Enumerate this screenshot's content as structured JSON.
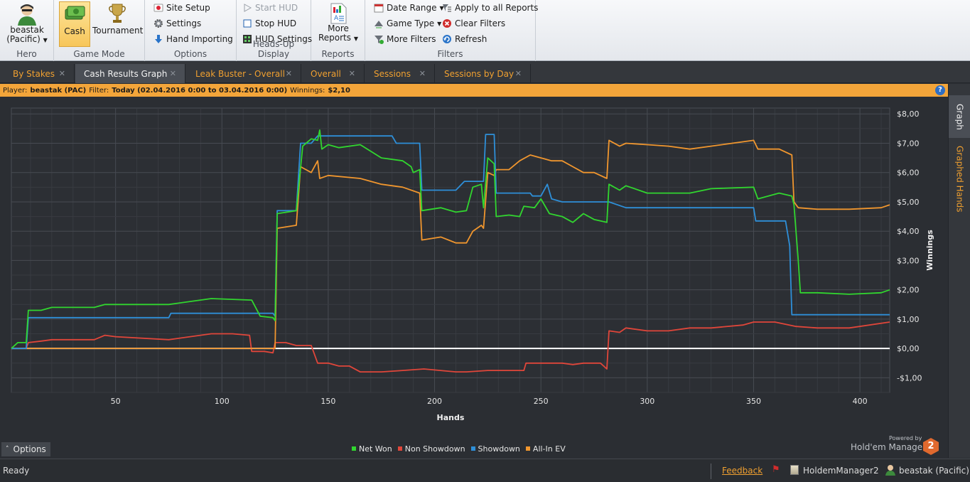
{
  "ribbon": {
    "hero": {
      "user_line1": "beastak",
      "user_line2": "(Pacific)",
      "group_label": "Hero"
    },
    "game_mode": {
      "cash": "Cash",
      "tournament": "Tournament",
      "group_label": "Game Mode"
    },
    "options": {
      "site_setup": "Site Setup",
      "settings": "Settings",
      "hand_importing": "Hand Importing",
      "group_label": "Options"
    },
    "hud": {
      "start_hud": "Start HUD",
      "stop_hud": "Stop HUD",
      "hud_settings": "HUD Settings",
      "group_label": "Heads-Up Display"
    },
    "reports": {
      "more_line1": "More",
      "more_line2": "Reports",
      "group_label": "Reports"
    },
    "filters": {
      "date_range": "Date Range",
      "game_type": "Game Type",
      "more_filters": "More Filters",
      "apply_all": "Apply to all Reports",
      "clear_filters": "Clear Filters",
      "refresh": "Refresh",
      "group_label": "Filters"
    }
  },
  "tabs": [
    {
      "label": "By Stakes"
    },
    {
      "label": "Cash Results Graph"
    },
    {
      "label": "Leak Buster - Overall"
    },
    {
      "label": "Overall"
    },
    {
      "label": "Sessions"
    },
    {
      "label": "Sessions by Day"
    }
  ],
  "active_tab": 1,
  "infobar": {
    "player_label": "Player:",
    "player_value": "beastak (PAC)",
    "filter_label": "Filter:",
    "filter_value": "Today (02.04.2016 0:00 to 03.04.2016 0:00)",
    "winnings_label": "Winnings:",
    "winnings_value": "$2,10",
    "help": "?"
  },
  "side_tabs": {
    "graph": "Graph",
    "graphed_hands": "Graphed Hands"
  },
  "options_button": "Options",
  "brand": {
    "powered_by": "Powered by",
    "name": "Hold'em Manager",
    "version": "2"
  },
  "status": {
    "ready": "Ready",
    "feedback": "Feedback",
    "db": "HoldemManager2",
    "user": "beastak (Pacific)"
  },
  "colors": {
    "net_won": "#31d62f",
    "non_showdown": "#e0463a",
    "showdown": "#2e8fd8",
    "allin_ev": "#f0962e",
    "accent": "#f3a53a"
  },
  "chart_data": {
    "type": "line",
    "xlabel": "Hands",
    "ylabel": "Winnings",
    "xlim": [
      1,
      414
    ],
    "ylim": [
      -1.5,
      8.2
    ],
    "x_ticks": [
      50,
      100,
      150,
      200,
      250,
      300,
      350,
      400
    ],
    "y_ticks": [
      {
        "v": 8,
        "label": "$8,00"
      },
      {
        "v": 7,
        "label": "$7,00"
      },
      {
        "v": 6,
        "label": "$6,00"
      },
      {
        "v": 5,
        "label": "$5,00"
      },
      {
        "v": 4,
        "label": "$4,00"
      },
      {
        "v": 3,
        "label": "$3,00"
      },
      {
        "v": 2,
        "label": "$2,00"
      },
      {
        "v": 1,
        "label": "$1,00"
      },
      {
        "v": 0,
        "label": "$0,00"
      },
      {
        "v": -1,
        "label": "-$1,00"
      }
    ],
    "grid": true,
    "legend_position": "bottom",
    "series": [
      {
        "name": "Net Won",
        "color_key": "net_won",
        "points": [
          [
            1,
            0
          ],
          [
            4,
            0.2
          ],
          [
            8,
            0.2
          ],
          [
            9,
            1.3
          ],
          [
            15,
            1.3
          ],
          [
            20,
            1.4
          ],
          [
            40,
            1.4
          ],
          [
            45,
            1.5
          ],
          [
            75,
            1.5
          ],
          [
            95,
            1.7
          ],
          [
            114,
            1.65
          ],
          [
            118,
            1.1
          ],
          [
            124,
            1.05
          ],
          [
            125,
            0.95
          ],
          [
            126,
            4.6
          ],
          [
            135,
            4.7
          ],
          [
            138,
            6.9
          ],
          [
            142,
            7.15
          ],
          [
            145,
            7.1
          ],
          [
            146,
            7.45
          ],
          [
            147,
            6.8
          ],
          [
            150,
            6.95
          ],
          [
            155,
            6.85
          ],
          [
            165,
            6.95
          ],
          [
            175,
            6.5
          ],
          [
            185,
            6.4
          ],
          [
            189,
            6.2
          ],
          [
            190,
            6.0
          ],
          [
            193,
            6.1
          ],
          [
            194,
            4.7
          ],
          [
            203,
            4.8
          ],
          [
            210,
            4.65
          ],
          [
            215,
            4.7
          ],
          [
            218,
            5.5
          ],
          [
            222,
            5.6
          ],
          [
            223,
            4.8
          ],
          [
            225,
            6.5
          ],
          [
            228,
            6.3
          ],
          [
            229,
            4.5
          ],
          [
            235,
            4.55
          ],
          [
            240,
            4.5
          ],
          [
            242,
            4.85
          ],
          [
            247,
            4.8
          ],
          [
            250,
            5.1
          ],
          [
            254,
            4.6
          ],
          [
            260,
            4.5
          ],
          [
            265,
            4.3
          ],
          [
            270,
            4.6
          ],
          [
            275,
            4.4
          ],
          [
            281,
            4.3
          ],
          [
            282,
            5.6
          ],
          [
            287,
            5.4
          ],
          [
            290,
            5.55
          ],
          [
            300,
            5.3
          ],
          [
            320,
            5.3
          ],
          [
            330,
            5.45
          ],
          [
            350,
            5.5
          ],
          [
            352,
            5.1
          ],
          [
            362,
            5.3
          ],
          [
            368,
            5.2
          ],
          [
            369,
            4.9
          ],
          [
            371,
            3.0
          ],
          [
            372,
            1.9
          ],
          [
            380,
            1.9
          ],
          [
            395,
            1.85
          ],
          [
            410,
            1.9
          ],
          [
            414,
            2.0
          ]
        ]
      },
      {
        "name": "Non Showdown",
        "color_key": "non_showdown",
        "points": [
          [
            1,
            0
          ],
          [
            8,
            0
          ],
          [
            9,
            0.2
          ],
          [
            15,
            0.25
          ],
          [
            20,
            0.3
          ],
          [
            40,
            0.3
          ],
          [
            45,
            0.45
          ],
          [
            50,
            0.4
          ],
          [
            75,
            0.3
          ],
          [
            95,
            0.5
          ],
          [
            105,
            0.5
          ],
          [
            113,
            0.45
          ],
          [
            114,
            -0.1
          ],
          [
            120,
            -0.1
          ],
          [
            124,
            -0.15
          ],
          [
            125,
            0.2
          ],
          [
            130,
            0.2
          ],
          [
            135,
            0.1
          ],
          [
            142,
            0.1
          ],
          [
            145,
            -0.5
          ],
          [
            150,
            -0.5
          ],
          [
            155,
            -0.6
          ],
          [
            160,
            -0.6
          ],
          [
            165,
            -0.8
          ],
          [
            175,
            -0.8
          ],
          [
            185,
            -0.75
          ],
          [
            195,
            -0.7
          ],
          [
            210,
            -0.8
          ],
          [
            215,
            -0.8
          ],
          [
            225,
            -0.75
          ],
          [
            242,
            -0.75
          ],
          [
            243,
            -0.5
          ],
          [
            260,
            -0.5
          ],
          [
            265,
            -0.55
          ],
          [
            270,
            -0.5
          ],
          [
            278,
            -0.5
          ],
          [
            281,
            -0.7
          ],
          [
            282,
            0.6
          ],
          [
            287,
            0.55
          ],
          [
            290,
            0.7
          ],
          [
            300,
            0.6
          ],
          [
            310,
            0.6
          ],
          [
            320,
            0.7
          ],
          [
            330,
            0.7
          ],
          [
            345,
            0.8
          ],
          [
            350,
            0.9
          ],
          [
            360,
            0.9
          ],
          [
            370,
            0.75
          ],
          [
            380,
            0.7
          ],
          [
            395,
            0.7
          ],
          [
            414,
            0.9
          ]
        ]
      },
      {
        "name": "Showdown",
        "color_key": "showdown",
        "points": [
          [
            1,
            0
          ],
          [
            8,
            0
          ],
          [
            9,
            1.05
          ],
          [
            20,
            1.05
          ],
          [
            40,
            1.05
          ],
          [
            75,
            1.05
          ],
          [
            76,
            1.2
          ],
          [
            113,
            1.2
          ],
          [
            114,
            1.2
          ],
          [
            124,
            1.2
          ],
          [
            125,
            1.1
          ],
          [
            126,
            4.7
          ],
          [
            135,
            4.7
          ],
          [
            137,
            7.0
          ],
          [
            142,
            7.0
          ],
          [
            145,
            7.25
          ],
          [
            150,
            7.25
          ],
          [
            165,
            7.25
          ],
          [
            180,
            7.25
          ],
          [
            182,
            7.0
          ],
          [
            193,
            7.0
          ],
          [
            194,
            5.4
          ],
          [
            210,
            5.4
          ],
          [
            214,
            5.7
          ],
          [
            218,
            5.7
          ],
          [
            223,
            5.7
          ],
          [
            224,
            7.3
          ],
          [
            228,
            7.3
          ],
          [
            229,
            5.3
          ],
          [
            245,
            5.3
          ],
          [
            246,
            5.2
          ],
          [
            250,
            5.2
          ],
          [
            253,
            5.6
          ],
          [
            255,
            5.1
          ],
          [
            260,
            5.0
          ],
          [
            281,
            5.0
          ],
          [
            282,
            5.0
          ],
          [
            290,
            4.8
          ],
          [
            315,
            4.8
          ],
          [
            345,
            4.8
          ],
          [
            350,
            4.8
          ],
          [
            351,
            4.35
          ],
          [
            365,
            4.35
          ],
          [
            367,
            3.5
          ],
          [
            368,
            1.15
          ],
          [
            380,
            1.15
          ],
          [
            414,
            1.15
          ]
        ]
      },
      {
        "name": "All-In EV",
        "color_key": "allin_ev",
        "points": [
          [
            1,
            0
          ],
          [
            8,
            0
          ],
          [
            125,
            0
          ],
          [
            126,
            4.1
          ],
          [
            135,
            4.2
          ],
          [
            137,
            6.2
          ],
          [
            142,
            6.0
          ],
          [
            145,
            6.4
          ],
          [
            146,
            5.8
          ],
          [
            150,
            5.9
          ],
          [
            165,
            5.8
          ],
          [
            175,
            5.6
          ],
          [
            185,
            5.5
          ],
          [
            193,
            5.3
          ],
          [
            194,
            3.7
          ],
          [
            203,
            3.8
          ],
          [
            210,
            3.6
          ],
          [
            215,
            3.6
          ],
          [
            218,
            4.0
          ],
          [
            222,
            4.2
          ],
          [
            223,
            4.1
          ],
          [
            225,
            6.0
          ],
          [
            228,
            5.9
          ],
          [
            229,
            6.1
          ],
          [
            235,
            6.1
          ],
          [
            240,
            6.4
          ],
          [
            245,
            6.6
          ],
          [
            250,
            6.5
          ],
          [
            255,
            6.4
          ],
          [
            260,
            6.4
          ],
          [
            265,
            6.2
          ],
          [
            270,
            6.0
          ],
          [
            275,
            6.0
          ],
          [
            281,
            5.8
          ],
          [
            282,
            7.1
          ],
          [
            287,
            6.9
          ],
          [
            290,
            7.0
          ],
          [
            300,
            6.95
          ],
          [
            310,
            6.9
          ],
          [
            320,
            6.8
          ],
          [
            330,
            6.9
          ],
          [
            340,
            7.0
          ],
          [
            350,
            7.1
          ],
          [
            352,
            6.8
          ],
          [
            362,
            6.8
          ],
          [
            368,
            6.6
          ],
          [
            369,
            5.0
          ],
          [
            371,
            4.8
          ],
          [
            380,
            4.75
          ],
          [
            395,
            4.75
          ],
          [
            410,
            4.8
          ],
          [
            414,
            4.9
          ]
        ]
      }
    ]
  }
}
